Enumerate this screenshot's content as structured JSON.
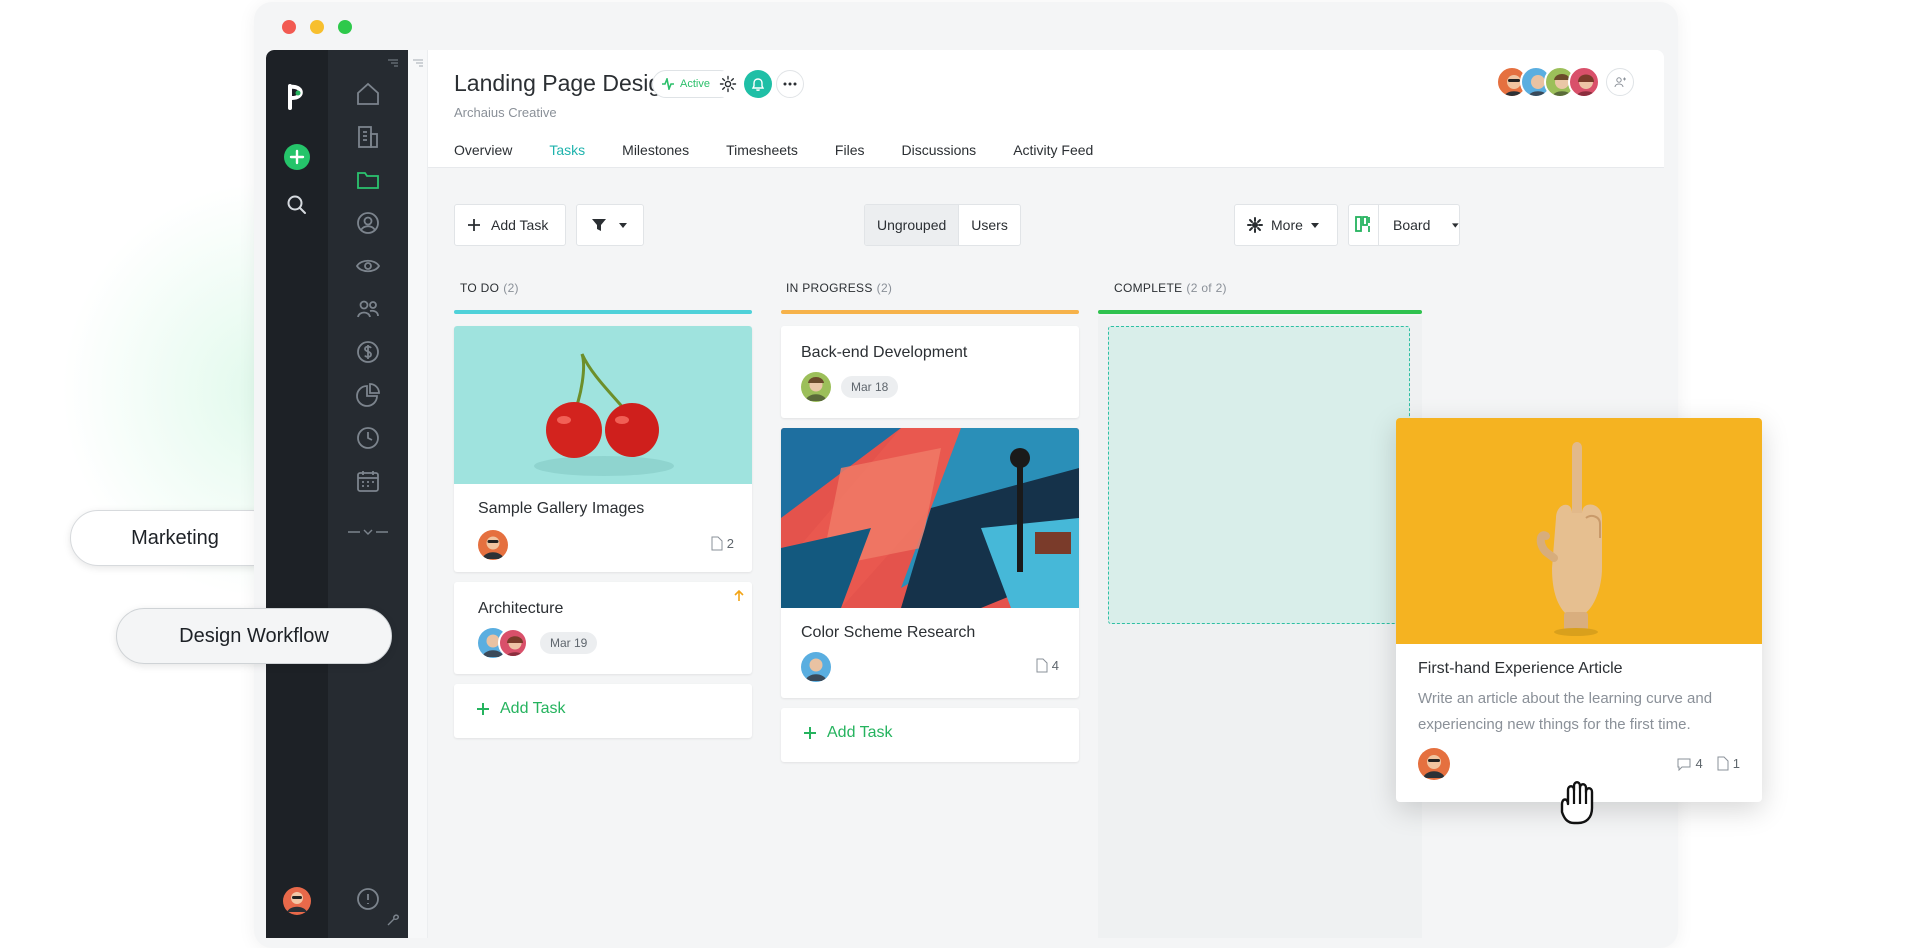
{
  "project": {
    "title": "Landing Page Design",
    "client": "Archaius Creative",
    "status": "Active"
  },
  "tabs": [
    {
      "label": "Overview",
      "active": false
    },
    {
      "label": "Tasks",
      "active": true
    },
    {
      "label": "Milestones",
      "active": false
    },
    {
      "label": "Timesheets",
      "active": false
    },
    {
      "label": "Files",
      "active": false
    },
    {
      "label": "Discussions",
      "active": false
    },
    {
      "label": "Activity Feed",
      "active": false
    }
  ],
  "toolbar": {
    "add_task": "Add Task",
    "group_ungrouped": "Ungrouped",
    "group_users": "Users",
    "more": "More",
    "view": "Board"
  },
  "columns": [
    {
      "title": "TO DO",
      "count": "(2)",
      "color": "#4fd1d9"
    },
    {
      "title": "IN PROGRESS",
      "count": "(2)",
      "color": "#f6b24a"
    },
    {
      "title": "COMPLETE",
      "count": "(2 of 2)",
      "color": "#2fc24f"
    }
  ],
  "cards": {
    "gallery": {
      "title": "Sample Gallery Images",
      "files": "2"
    },
    "architecture": {
      "title": "Architecture",
      "date": "Mar 19"
    },
    "backend": {
      "title": "Back-end Development",
      "date": "Mar 18"
    },
    "color": {
      "title": "Color Scheme Research",
      "files": "4"
    },
    "article": {
      "title": "First-hand Experience Article",
      "description": "Write an article about the learning curve and experiencing new things for the first time.",
      "comments": "4",
      "files": "1"
    }
  },
  "add_task_label": "Add Task",
  "floating_labels": {
    "marketing": "Marketing",
    "design_workflow": "Design Workflow"
  },
  "colors": {
    "accent": "#25b35e",
    "teal": "#1fb3ad",
    "rail": "#1d2126",
    "nav": "#262b31"
  }
}
